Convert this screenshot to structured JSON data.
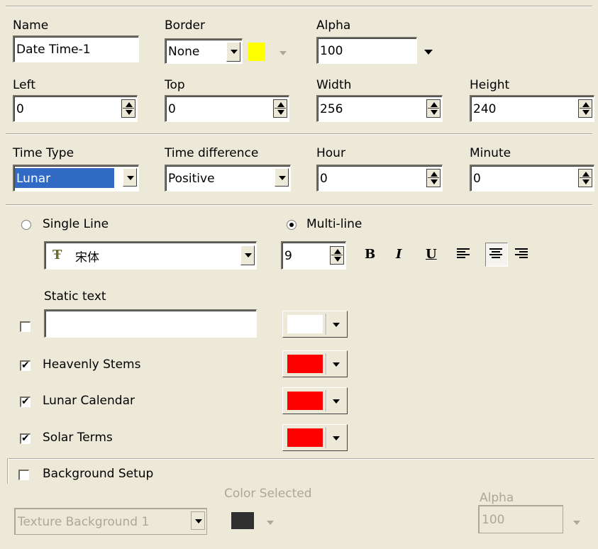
{
  "name": {
    "label": "Name",
    "value": "Date Time-1"
  },
  "border": {
    "label": "Border",
    "value": "None",
    "color": "#ffff00"
  },
  "alpha": {
    "label": "Alpha",
    "value": "100"
  },
  "left": {
    "label": "Left",
    "value": "0"
  },
  "top": {
    "label": "Top",
    "value": "0"
  },
  "width": {
    "label": "Width",
    "value": "256"
  },
  "height": {
    "label": "Height",
    "value": "240"
  },
  "time_type": {
    "label": "Time Type",
    "value": "Lunar"
  },
  "time_difference": {
    "label": "Time difference",
    "value": "Positive"
  },
  "hour": {
    "label": "Hour",
    "value": "0"
  },
  "minute": {
    "label": "Minute",
    "value": "0"
  },
  "layout": {
    "single_line": {
      "label": "Single Line",
      "selected": false
    },
    "multi_line": {
      "label": "Multi-line",
      "selected": true
    }
  },
  "font": {
    "name": "宋体",
    "icon": "truetype-font-icon",
    "size": "9",
    "bold": "B",
    "italic": "I",
    "underline": "U",
    "align_selected": "center"
  },
  "static_text": {
    "label": "Static text",
    "checked": false,
    "value": "",
    "color": "#ffffff"
  },
  "options": [
    {
      "label": "Heavenly Stems",
      "checked": true,
      "color": "#ff0000"
    },
    {
      "label": "Lunar Calendar",
      "checked": true,
      "color": "#ff0000"
    },
    {
      "label": "Solar Terms",
      "checked": true,
      "color": "#ff0000"
    }
  ],
  "background": {
    "label": "Background Setup",
    "checked": false,
    "color_selected_label": "Color Selected",
    "texture": "Texture Background 1",
    "color": "#303030",
    "alpha_label": "Alpha",
    "alpha": "100"
  }
}
